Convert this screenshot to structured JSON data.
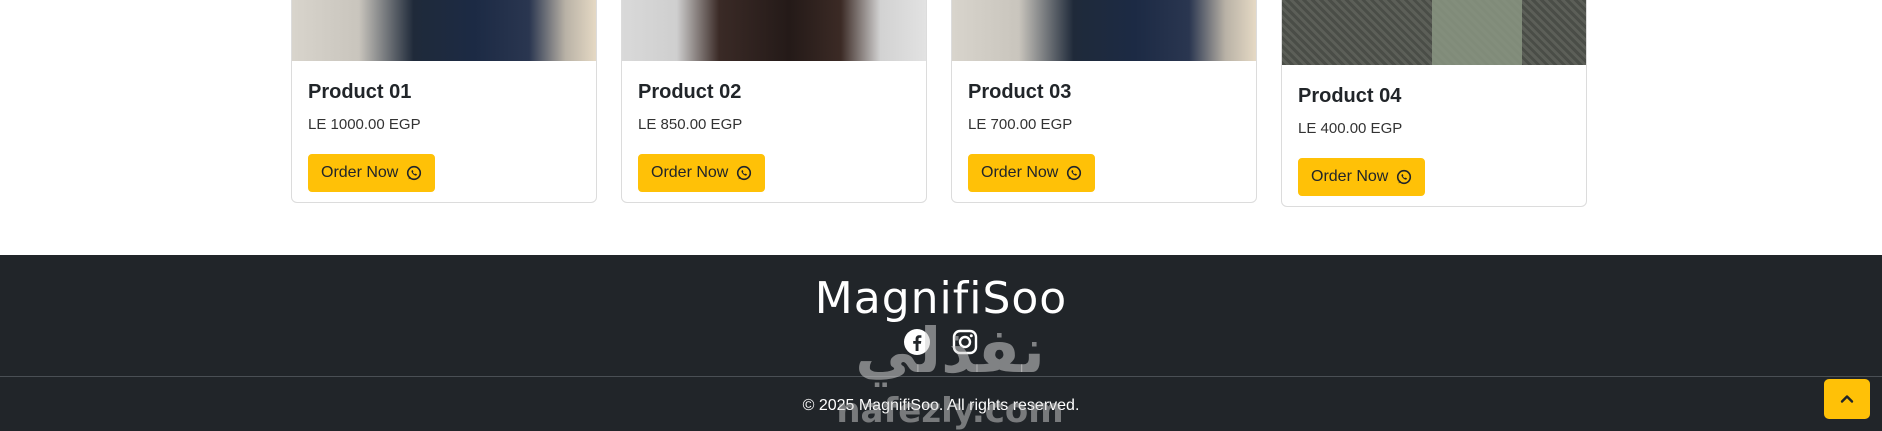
{
  "products": [
    {
      "title": "Product 01",
      "price": "LE 1000.00 EGP",
      "button": "Order Now"
    },
    {
      "title": "Product 02",
      "price": "LE 850.00 EGP",
      "button": "Order Now"
    },
    {
      "title": "Product 03",
      "price": "LE 700.00 EGP",
      "button": "Order Now"
    },
    {
      "title": "Product 04",
      "price": "LE 400.00 EGP",
      "button": "Order Now"
    }
  ],
  "footer": {
    "brand": "MagnifiSoo",
    "social": [
      "facebook-icon",
      "instagram-icon"
    ],
    "copyright": "© 2025 MagnifiSoo. All rights reserved."
  },
  "watermark": {
    "arabic": "نفذلي",
    "latin": "nafezly.com"
  },
  "colors": {
    "accent": "#ffc107",
    "footer_bg": "#212529"
  }
}
